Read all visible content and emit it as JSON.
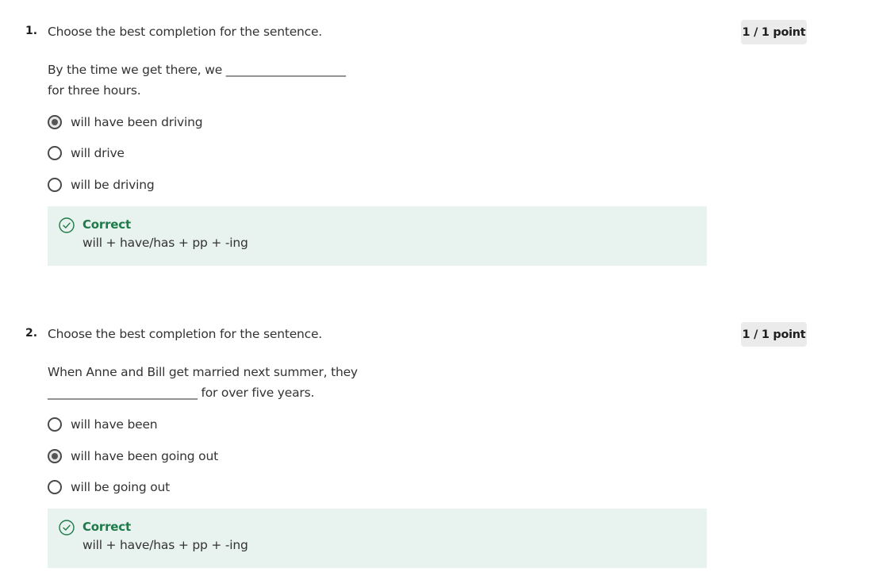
{
  "questions": [
    {
      "number": "1.",
      "prompt": "Choose the best completion for the sentence.",
      "points": "1 / 1 point",
      "sentence_lines": [
        "By the time we get there, we ____________________",
        "for three hours."
      ],
      "options": [
        {
          "label": "will have been driving",
          "selected": true
        },
        {
          "label": "will drive",
          "selected": false
        },
        {
          "label": "will be driving",
          "selected": false
        }
      ],
      "feedback": {
        "status": "Correct",
        "explanation": "will + have/has + pp + -ing",
        "icon": "check-circle-icon",
        "color": "#1f7a4a"
      }
    },
    {
      "number": "2.",
      "prompt": "Choose the best completion for the sentence.",
      "points": "1 / 1 point",
      "sentence_lines": [
        "When Anne and Bill get married next summer, they",
        "_________________________ for over five years."
      ],
      "options": [
        {
          "label": "will have been",
          "selected": false
        },
        {
          "label": "will have been going out",
          "selected": true
        },
        {
          "label": "will be going out",
          "selected": false
        }
      ],
      "feedback": {
        "status": "Correct",
        "explanation": "will + have/has + pp + -ing",
        "icon": "check-circle-icon",
        "color": "#1f7a4a"
      }
    }
  ]
}
